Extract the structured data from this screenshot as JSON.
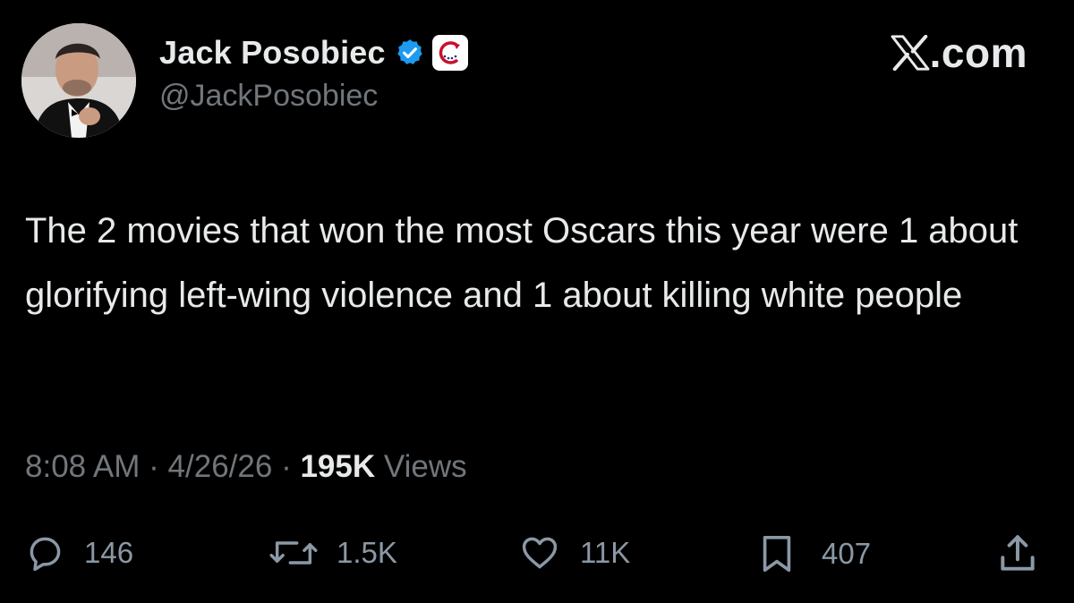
{
  "author": {
    "name": "Jack Posobiec",
    "handle": "@JackPosobiec"
  },
  "brand": {
    "label": "X.com"
  },
  "tweet": {
    "text": "The 2 movies that won the most Oscars this year were 1 about glorifying left-wing violence and 1 about killing white people"
  },
  "meta": {
    "time": "8:08 AM",
    "date": "4/26/26",
    "views_count": "195K",
    "views_label": "Views",
    "separator": "·"
  },
  "actions": {
    "replies": "146",
    "reposts": "1.5K",
    "likes": "11K",
    "bookmarks": "407"
  },
  "colors": {
    "background": "#000000",
    "text": "#e7e9ea",
    "secondary": "#71767b",
    "verified": "#1d9bf0"
  },
  "icons": [
    "avatar-photo",
    "verified-badge-icon",
    "affiliation-badge-icon",
    "x-logo-icon",
    "reply-icon",
    "repost-icon",
    "like-icon",
    "bookmark-icon",
    "share-icon"
  ]
}
